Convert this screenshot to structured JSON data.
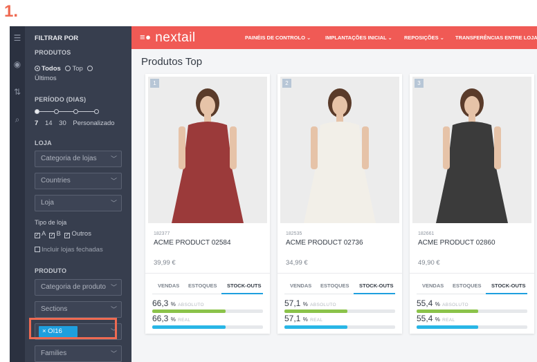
{
  "step_label": "1.",
  "sidebar": {
    "header": "FILTRAR POR",
    "products_section": "PRODUTOS",
    "products_options": [
      "Todos",
      "Top",
      "Últimos"
    ],
    "period_section": "PERÍODO (DIAS)",
    "period_ticks": [
      "7",
      "14",
      "30",
      "Personalizado"
    ],
    "store_section": "LOJA",
    "store_selects": [
      "Categoria de lojas",
      "Countries",
      "Loja"
    ],
    "store_type_label": "Tipo de loja",
    "store_types": [
      "A",
      "B",
      "Outros"
    ],
    "include_closed": "Incluir lojas fechadas",
    "product_section": "PRODUTO",
    "product_selects": [
      "Categoria de produto",
      "Sections"
    ],
    "chip": "× OI16",
    "families_select": "Families"
  },
  "topbar": {
    "logo": "nextail",
    "nav": [
      "PAINÉIS DE CONTROLO ⌄",
      "IMPLANTAÇÕES INICIAL ⌄",
      "REPOSIÇÕES ⌄",
      "TRANSFERÊNCIAS ENTRE LOJAS"
    ]
  },
  "main": {
    "title": "Produtos Top",
    "tabs": [
      "VENDAS",
      "ESTOQUES",
      "STOCK-OUTS"
    ],
    "absolute_label": "ABSOLUTO",
    "real_label": "REAL",
    "percent_unit": "%",
    "products": [
      {
        "rank": "1",
        "code": "182377",
        "name": "ACME PRODUCT 02584",
        "price": "39,99 €",
        "absolute": "66,3",
        "real": "66,3",
        "absolute_fill": 0.663,
        "real_fill": 0.663,
        "dress_color": "#9b3a3a"
      },
      {
        "rank": "2",
        "code": "182535",
        "name": "ACME PRODUCT 02736",
        "price": "34,99 €",
        "absolute": "57,1",
        "real": "57,1",
        "absolute_fill": 0.571,
        "real_fill": 0.571,
        "dress_color": "#f2efe8"
      },
      {
        "rank": "3",
        "code": "182661",
        "name": "ACME PRODUCT 02860",
        "price": "49,90 €",
        "absolute": "55,4",
        "real": "55,4",
        "absolute_fill": 0.554,
        "real_fill": 0.554,
        "dress_color": "#3b3b3b"
      }
    ]
  },
  "colors": {
    "accent": "#f05a55",
    "absolute_bar": "#8bc34a",
    "real_bar": "#29b6e6",
    "chip": "#1e9fde",
    "highlight": "#ef6a52"
  }
}
